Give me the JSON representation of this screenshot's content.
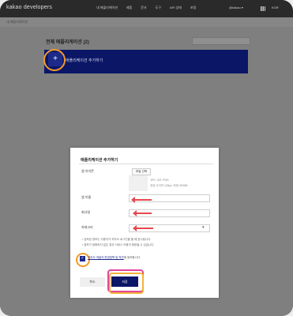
{
  "header": {
    "logo": "kakao developers",
    "nav": [
      "내 애플리케이션",
      "제품",
      "문서",
      "도구",
      "API 상태",
      "포럼"
    ],
    "account": "@kakao ▾",
    "language": "KOR"
  },
  "breadcrumb": "내 애플리케이션",
  "apps": {
    "title": "전체 애플리케이션 (2)",
    "add_label": "애플리케이션 추가하기",
    "plus": "+"
  },
  "modal": {
    "title": "애플리케이션 추가하기",
    "icon_label": "앱 아이콘",
    "upload_label": "파일 선택",
    "hint_lines": [
      "JPG, GIF, PNG",
      "권장 사이즈 128px, 최대 250KB"
    ],
    "app_name_label": "앱 이름",
    "company_label": "회사명",
    "category_label": "카테고리",
    "category_arrow": "▾",
    "notes": [
      "• 입력된 정보는 사용자가 카카오 로그인을 할 때 표시됩니다.",
      "• 정보가 정확하지 않은 경우 서비스 이용이 제한될 수 있습니다."
    ],
    "agree_check": "✓",
    "agree_link": "카카오 개발자 운영정책 및 약관",
    "agree_text": "에 동의합니다.",
    "cancel_label": "취소",
    "save_label": "저장"
  },
  "colors": {
    "nav_bg": "#2a2a2a",
    "primary": "#0b1666",
    "arrow_red": "#e5484d",
    "highlight_orange": "#f39a2a",
    "highlight_pink": "#e2469a"
  }
}
